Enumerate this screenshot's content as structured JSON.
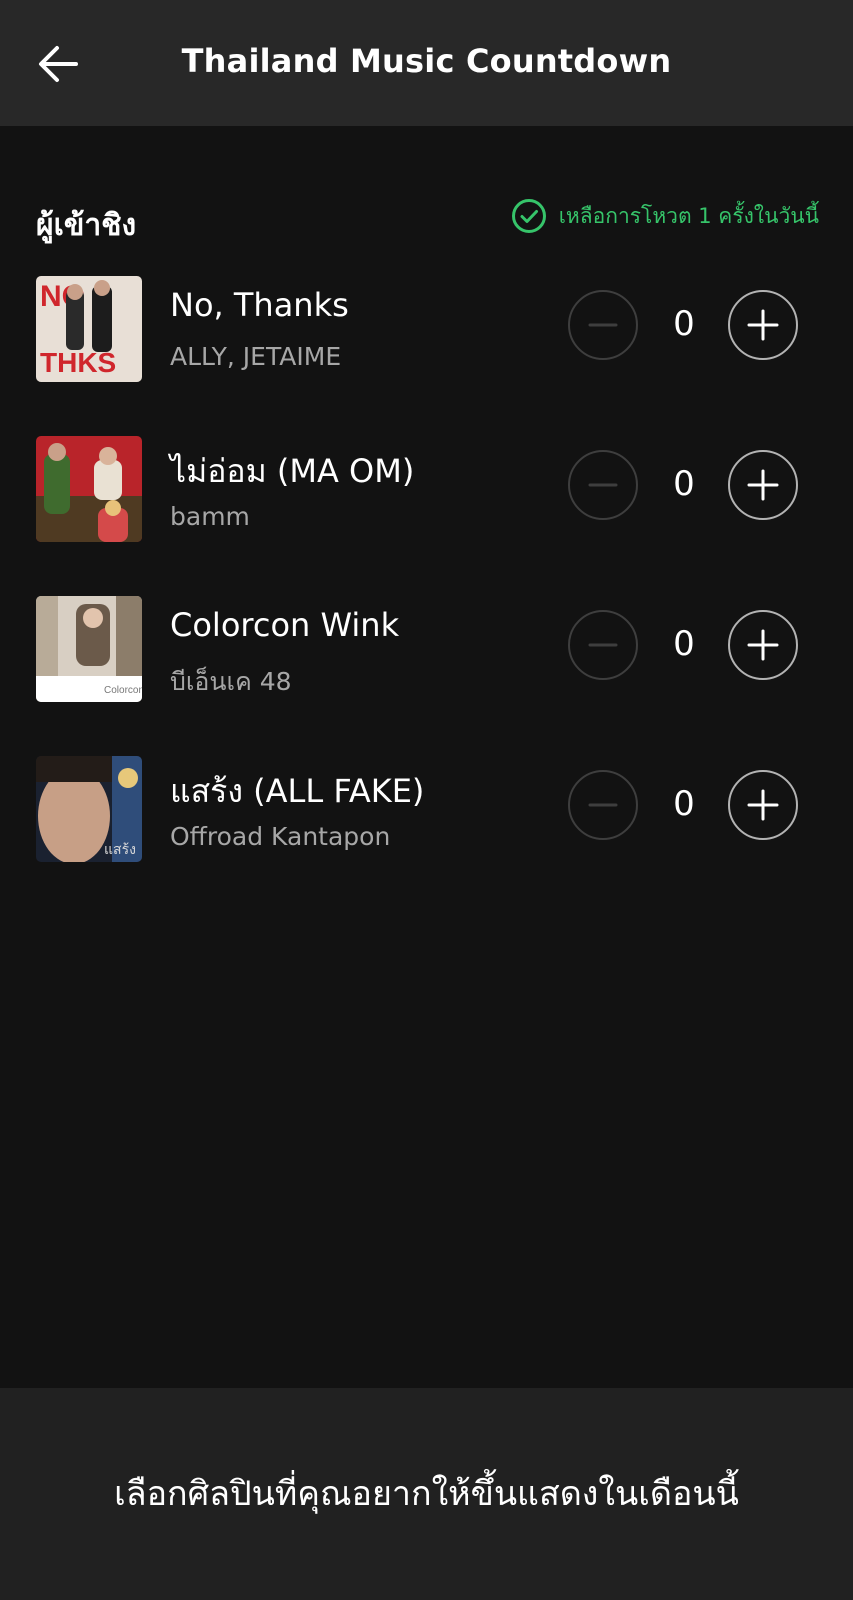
{
  "header": {
    "title": "Thailand Music Countdown",
    "back_icon": "arrow-left-icon"
  },
  "section": {
    "title": "ผู้เข้าชิง",
    "votes_left_text": "เหลือการโหวต 1 ครั้งในวันนี้",
    "votes_left_icon": "check-circle-icon",
    "accent_color": "#36c46a"
  },
  "nominees": [
    {
      "title": "No, Thanks",
      "artist": "ALLY, JETAIME",
      "count": "0",
      "cover_palette": [
        "#e8dfd6",
        "#d0262c",
        "#1c1c1c"
      ]
    },
    {
      "title": "ไม่อ่อม (MA OM)",
      "artist": "bamm",
      "count": "0",
      "cover_palette": [
        "#b9242a",
        "#4f3a22",
        "#e9e1d3"
      ]
    },
    {
      "title": "Colorcon Wink",
      "artist": "บีเอ็นเค 48",
      "count": "0",
      "cover_palette": [
        "#d8cfc3",
        "#6b5a4a",
        "#ffffff"
      ]
    },
    {
      "title": "แสร้ง (ALL FAKE)",
      "artist": "Offroad Kantapon",
      "count": "0",
      "cover_palette": [
        "#1a2130",
        "#c79f86",
        "#2f4d7a"
      ]
    }
  ],
  "controls": {
    "minus_icon": "minus-icon",
    "plus_icon": "plus-icon"
  },
  "footer": {
    "text": "เลือกศิลปินที่คุณอยากให้ขึ้นแสดงในเดือนนี้"
  }
}
